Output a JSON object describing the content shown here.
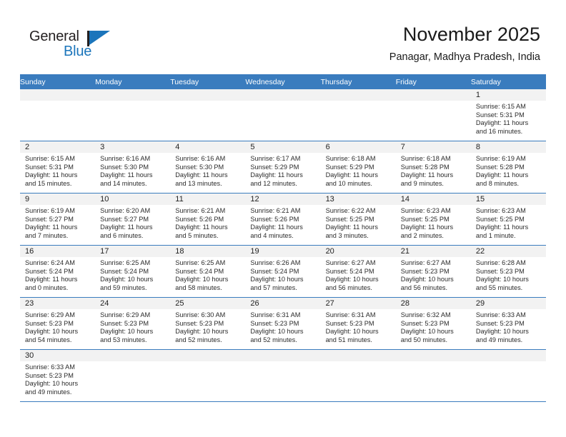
{
  "brand": {
    "name_top": "General",
    "name_bottom": "Blue",
    "accent_color": "#1b75bb",
    "dark_color": "#231f20"
  },
  "header": {
    "title": "November 2025",
    "subtitle": "Panagar, Madhya Pradesh, India"
  },
  "calendar": {
    "header_bg": "#3a7cbe",
    "daynum_bg": "#f2f2f2",
    "weekdays": [
      "Sunday",
      "Monday",
      "Tuesday",
      "Wednesday",
      "Thursday",
      "Friday",
      "Saturday"
    ],
    "weeks": [
      [
        {
          "day": "",
          "lines": []
        },
        {
          "day": "",
          "lines": []
        },
        {
          "day": "",
          "lines": []
        },
        {
          "day": "",
          "lines": []
        },
        {
          "day": "",
          "lines": []
        },
        {
          "day": "",
          "lines": []
        },
        {
          "day": "1",
          "lines": [
            "Sunrise: 6:15 AM",
            "Sunset: 5:31 PM",
            "Daylight: 11 hours",
            "and 16 minutes."
          ]
        }
      ],
      [
        {
          "day": "2",
          "lines": [
            "Sunrise: 6:15 AM",
            "Sunset: 5:31 PM",
            "Daylight: 11 hours",
            "and 15 minutes."
          ]
        },
        {
          "day": "3",
          "lines": [
            "Sunrise: 6:16 AM",
            "Sunset: 5:30 PM",
            "Daylight: 11 hours",
            "and 14 minutes."
          ]
        },
        {
          "day": "4",
          "lines": [
            "Sunrise: 6:16 AM",
            "Sunset: 5:30 PM",
            "Daylight: 11 hours",
            "and 13 minutes."
          ]
        },
        {
          "day": "5",
          "lines": [
            "Sunrise: 6:17 AM",
            "Sunset: 5:29 PM",
            "Daylight: 11 hours",
            "and 12 minutes."
          ]
        },
        {
          "day": "6",
          "lines": [
            "Sunrise: 6:18 AM",
            "Sunset: 5:29 PM",
            "Daylight: 11 hours",
            "and 10 minutes."
          ]
        },
        {
          "day": "7",
          "lines": [
            "Sunrise: 6:18 AM",
            "Sunset: 5:28 PM",
            "Daylight: 11 hours",
            "and 9 minutes."
          ]
        },
        {
          "day": "8",
          "lines": [
            "Sunrise: 6:19 AM",
            "Sunset: 5:28 PM",
            "Daylight: 11 hours",
            "and 8 minutes."
          ]
        }
      ],
      [
        {
          "day": "9",
          "lines": [
            "Sunrise: 6:19 AM",
            "Sunset: 5:27 PM",
            "Daylight: 11 hours",
            "and 7 minutes."
          ]
        },
        {
          "day": "10",
          "lines": [
            "Sunrise: 6:20 AM",
            "Sunset: 5:27 PM",
            "Daylight: 11 hours",
            "and 6 minutes."
          ]
        },
        {
          "day": "11",
          "lines": [
            "Sunrise: 6:21 AM",
            "Sunset: 5:26 PM",
            "Daylight: 11 hours",
            "and 5 minutes."
          ]
        },
        {
          "day": "12",
          "lines": [
            "Sunrise: 6:21 AM",
            "Sunset: 5:26 PM",
            "Daylight: 11 hours",
            "and 4 minutes."
          ]
        },
        {
          "day": "13",
          "lines": [
            "Sunrise: 6:22 AM",
            "Sunset: 5:25 PM",
            "Daylight: 11 hours",
            "and 3 minutes."
          ]
        },
        {
          "day": "14",
          "lines": [
            "Sunrise: 6:23 AM",
            "Sunset: 5:25 PM",
            "Daylight: 11 hours",
            "and 2 minutes."
          ]
        },
        {
          "day": "15",
          "lines": [
            "Sunrise: 6:23 AM",
            "Sunset: 5:25 PM",
            "Daylight: 11 hours",
            "and 1 minute."
          ]
        }
      ],
      [
        {
          "day": "16",
          "lines": [
            "Sunrise: 6:24 AM",
            "Sunset: 5:24 PM",
            "Daylight: 11 hours",
            "and 0 minutes."
          ]
        },
        {
          "day": "17",
          "lines": [
            "Sunrise: 6:25 AM",
            "Sunset: 5:24 PM",
            "Daylight: 10 hours",
            "and 59 minutes."
          ]
        },
        {
          "day": "18",
          "lines": [
            "Sunrise: 6:25 AM",
            "Sunset: 5:24 PM",
            "Daylight: 10 hours",
            "and 58 minutes."
          ]
        },
        {
          "day": "19",
          "lines": [
            "Sunrise: 6:26 AM",
            "Sunset: 5:24 PM",
            "Daylight: 10 hours",
            "and 57 minutes."
          ]
        },
        {
          "day": "20",
          "lines": [
            "Sunrise: 6:27 AM",
            "Sunset: 5:24 PM",
            "Daylight: 10 hours",
            "and 56 minutes."
          ]
        },
        {
          "day": "21",
          "lines": [
            "Sunrise: 6:27 AM",
            "Sunset: 5:23 PM",
            "Daylight: 10 hours",
            "and 56 minutes."
          ]
        },
        {
          "day": "22",
          "lines": [
            "Sunrise: 6:28 AM",
            "Sunset: 5:23 PM",
            "Daylight: 10 hours",
            "and 55 minutes."
          ]
        }
      ],
      [
        {
          "day": "23",
          "lines": [
            "Sunrise: 6:29 AM",
            "Sunset: 5:23 PM",
            "Daylight: 10 hours",
            "and 54 minutes."
          ]
        },
        {
          "day": "24",
          "lines": [
            "Sunrise: 6:29 AM",
            "Sunset: 5:23 PM",
            "Daylight: 10 hours",
            "and 53 minutes."
          ]
        },
        {
          "day": "25",
          "lines": [
            "Sunrise: 6:30 AM",
            "Sunset: 5:23 PM",
            "Daylight: 10 hours",
            "and 52 minutes."
          ]
        },
        {
          "day": "26",
          "lines": [
            "Sunrise: 6:31 AM",
            "Sunset: 5:23 PM",
            "Daylight: 10 hours",
            "and 52 minutes."
          ]
        },
        {
          "day": "27",
          "lines": [
            "Sunrise: 6:31 AM",
            "Sunset: 5:23 PM",
            "Daylight: 10 hours",
            "and 51 minutes."
          ]
        },
        {
          "day": "28",
          "lines": [
            "Sunrise: 6:32 AM",
            "Sunset: 5:23 PM",
            "Daylight: 10 hours",
            "and 50 minutes."
          ]
        },
        {
          "day": "29",
          "lines": [
            "Sunrise: 6:33 AM",
            "Sunset: 5:23 PM",
            "Daylight: 10 hours",
            "and 49 minutes."
          ]
        }
      ],
      [
        {
          "day": "30",
          "lines": [
            "Sunrise: 6:33 AM",
            "Sunset: 5:23 PM",
            "Daylight: 10 hours",
            "and 49 minutes."
          ]
        },
        {
          "day": "",
          "lines": []
        },
        {
          "day": "",
          "lines": []
        },
        {
          "day": "",
          "lines": []
        },
        {
          "day": "",
          "lines": []
        },
        {
          "day": "",
          "lines": []
        },
        {
          "day": "",
          "lines": []
        }
      ]
    ]
  }
}
